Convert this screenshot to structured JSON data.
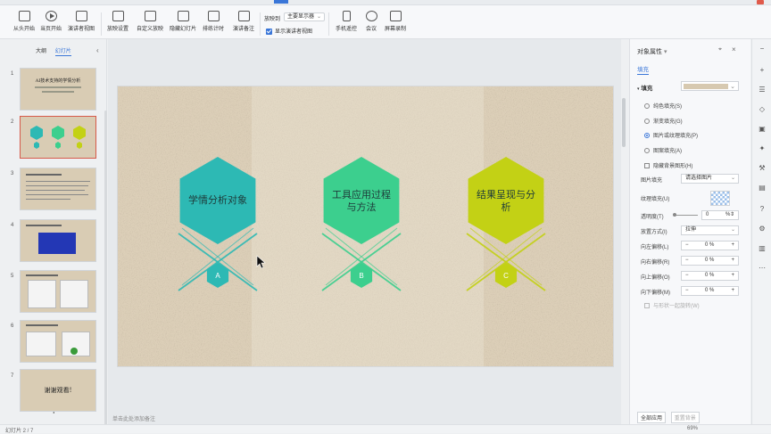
{
  "ribbon": {
    "buttons": [
      "从头开始",
      "当页开始",
      "演讲者视图",
      "放映设置",
      "自定义放映",
      "隐藏幻灯片",
      "排练计时",
      "演讲备注",
      "手机遥控",
      "会议",
      "屏幕录制"
    ],
    "screen_label": "放映到",
    "screen_value": "主要显示器",
    "presenter_view_label": "显示演讲者视图"
  },
  "left_panel": {
    "tab_outline": "大纲",
    "tab_slides": "幻灯片",
    "slide_numbers": [
      "1",
      "2",
      "3",
      "4",
      "5",
      "6",
      "7"
    ],
    "slide1_title": "AI技术支持的学情分析",
    "slide7_title": "谢谢观看!",
    "add_label": "+"
  },
  "slide": {
    "hexagons": [
      {
        "title": "学情分析对象",
        "letter": "A",
        "color": "#2db9b4"
      },
      {
        "title": "工具应用过程与方法",
        "letter": "B",
        "color": "#3ccf8e"
      },
      {
        "title": "结果呈现与分析",
        "letter": "C",
        "color": "#c3d115"
      }
    ],
    "background_color": "#d9ccb4"
  },
  "notes_placeholder": "单击此处添加备注",
  "right_panel": {
    "title": "对象属性",
    "tab": "填充",
    "section": "填充",
    "options": [
      "纯色填充(S)",
      "渐变填充(G)",
      "图片或纹理填充(P)",
      "图案填充(A)"
    ],
    "selected_option": 2,
    "hide_bg": "隐藏背景图形(H)",
    "picture_fill_label": "图片填充",
    "picture_fill_value": "请选择图片",
    "texture_label": "纹理填充(U)",
    "transparency_label": "透明度(T)",
    "transparency_value": "0",
    "transparency_unit": "%",
    "placement_label": "放置方式(I)",
    "placement_value": "拉伸",
    "offsets": [
      {
        "label": "向左偏移(L)",
        "value": "0 %"
      },
      {
        "label": "向右偏移(R)",
        "value": "0 %"
      },
      {
        "label": "向上偏移(O)",
        "value": "0 %"
      },
      {
        "label": "向下偏移(M)",
        "value": "0 %"
      }
    ],
    "rotate_with_shape": "与形状一起旋转(W)",
    "apply_all": "全部应用",
    "reset_bg": "重置背景"
  },
  "status_bar": {
    "slide_info": "幻灯片 2 / 7",
    "zoom": "69%"
  }
}
